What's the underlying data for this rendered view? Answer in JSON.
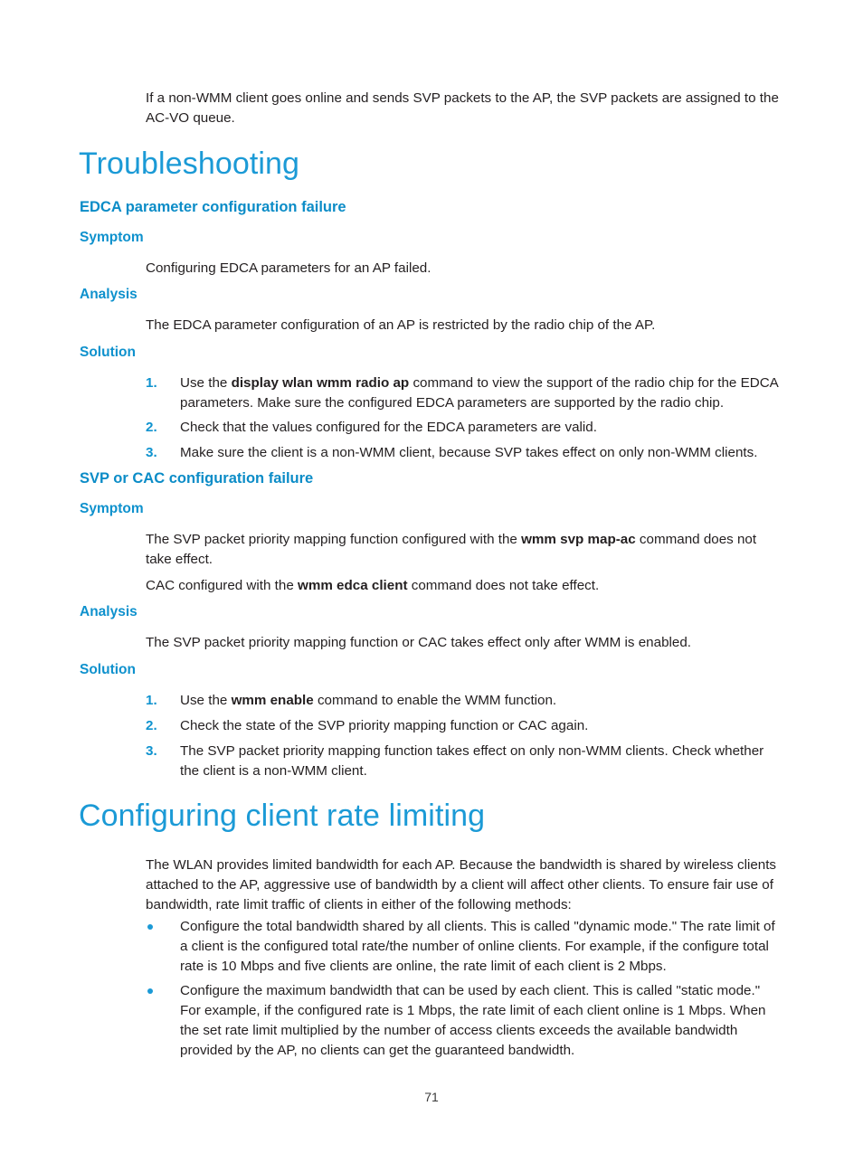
{
  "page": {
    "number": "71"
  },
  "intro": {
    "paragraph": "If a non-WMM client goes online and sends SVP packets to the AP, the SVP packets are assigned to the AC-VO queue."
  },
  "troubleshooting": {
    "heading": "Troubleshooting",
    "sections": [
      {
        "heading": "EDCA parameter configuration failure",
        "symptom_heading": "Symptom",
        "symptom_text": "Configuring EDCA parameters for an AP failed.",
        "analysis_heading": "Analysis",
        "analysis_text": "The EDCA parameter configuration of an AP is restricted by the radio chip of the AP.",
        "solution_heading": "Solution",
        "steps": [
          {
            "number": "1.",
            "pre": "Use the ",
            "command": "display wlan wmm radio ap",
            "post": " command to view the support of the radio chip for the EDCA parameters. Make sure the configured EDCA parameters are supported by the radio chip."
          },
          {
            "number": "2.",
            "pre": "Check that the values configured for the EDCA parameters are valid.",
            "command": "",
            "post": ""
          },
          {
            "number": "3.",
            "pre": "Make sure the client is a non-WMM client, because SVP takes effect on only non-WMM clients.",
            "command": "",
            "post": ""
          }
        ]
      },
      {
        "heading": "SVP or CAC configuration failure",
        "symptom_heading": "Symptom",
        "symptom_paragraph_1_pre": "The SVP packet priority mapping function configured with the ",
        "symptom_paragraph_1_command": "wmm svp map-ac",
        "symptom_paragraph_1_post": " command does not take effect.",
        "symptom_paragraph_2_pre": "CAC configured with the ",
        "symptom_paragraph_2_command": "wmm edca client",
        "symptom_paragraph_2_post": " command does not take effect.",
        "analysis_heading": "Analysis",
        "analysis_text": "The SVP packet priority mapping function or CAC takes effect only after WMM is enabled.",
        "solution_heading": "Solution",
        "steps": [
          {
            "number": "1.",
            "pre": "Use the ",
            "command": "wmm enable",
            "post": " command to enable the WMM function."
          },
          {
            "number": "2.",
            "pre": "Check the state of the SVP priority mapping function or CAC again.",
            "command": "",
            "post": ""
          },
          {
            "number": "3.",
            "pre": "The SVP packet priority mapping function takes effect on only non-WMM clients. Check whether the client is a non-WMM client.",
            "command": "",
            "post": ""
          }
        ]
      }
    ]
  },
  "rate_limiting": {
    "heading": "Configuring client rate limiting",
    "intro": "The WLAN provides limited bandwidth for each AP. Because the bandwidth is shared by wireless clients attached to the AP, aggressive use of bandwidth by a client will affect other clients. To ensure fair use of bandwidth, rate limit traffic of clients in either of the following methods:",
    "bullets": [
      "Configure the total bandwidth shared by all clients. This is called \"dynamic mode.\" The rate limit of a client is the configured total rate/the number of online clients. For example, if the configure total rate is 10 Mbps and five clients are online, the rate limit of each client is 2 Mbps.",
      "Configure the maximum bandwidth that can be used by each client. This is called \"static mode.\" For example, if the configured rate is 1 Mbps, the rate limit of each client online is 1 Mbps. When the set rate limit multiplied by the number of access clients exceeds the available bandwidth provided by the AP, no clients can get the guaranteed bandwidth."
    ]
  },
  "colors": {
    "heading_primary": "#1b9ad6",
    "heading_secondary": "#0b8cc7",
    "heading_tertiary": "#0e91cd",
    "body": "#231f20"
  }
}
